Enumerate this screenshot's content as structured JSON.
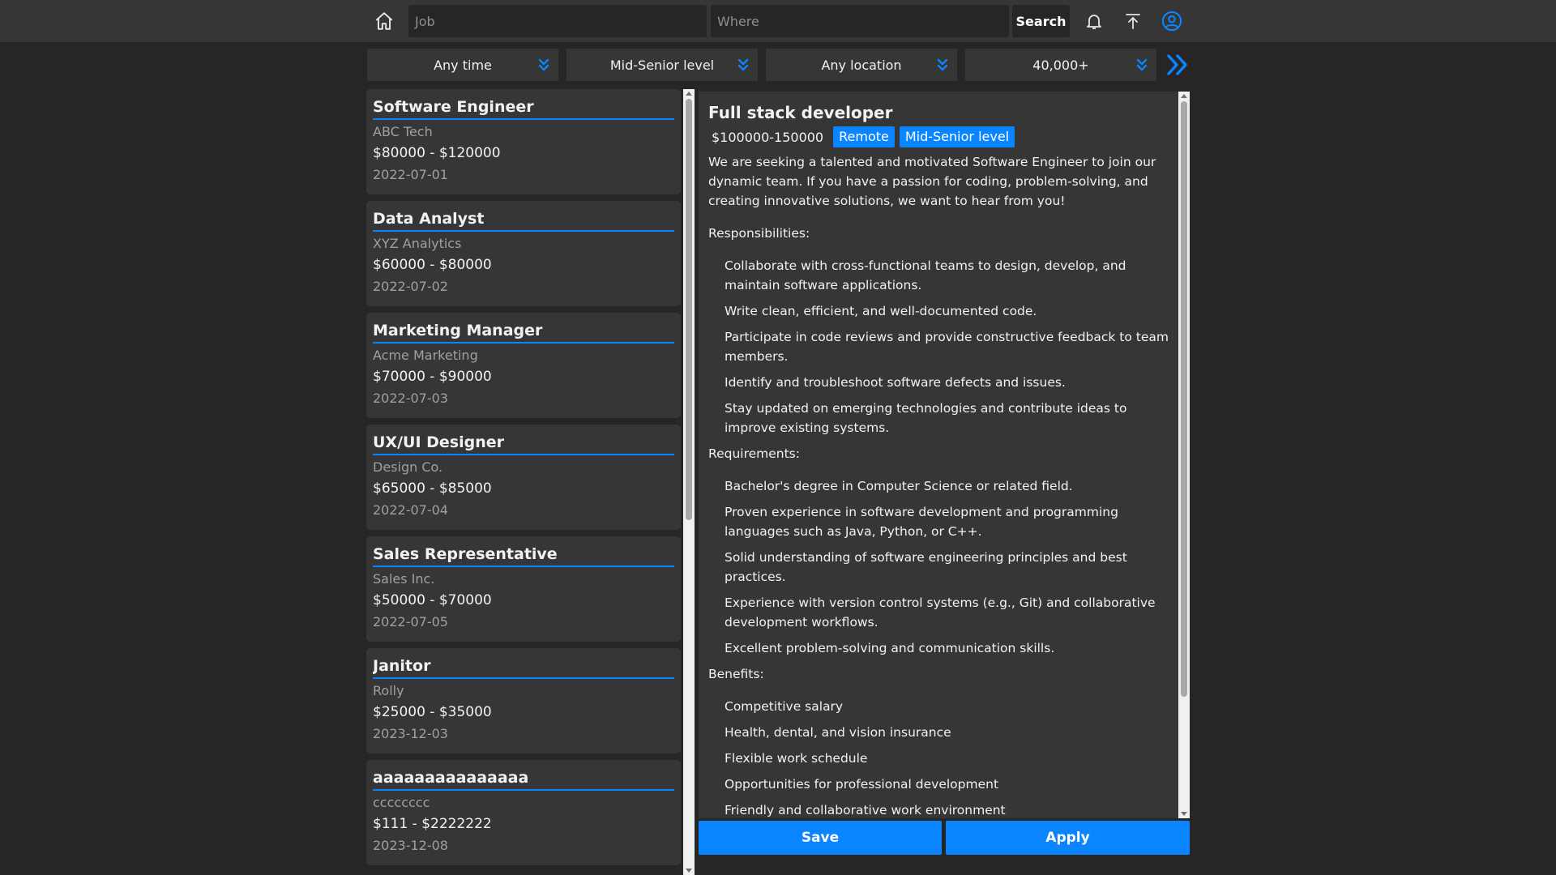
{
  "colors": {
    "accent": "#0a84ff",
    "background": "#262626",
    "surface": "#363636"
  },
  "header": {
    "home_icon": "home-icon",
    "job_placeholder": "Job",
    "where_placeholder": "Where",
    "search_label": "Search",
    "notification_icon": "bell-icon",
    "upload_icon": "upload-icon",
    "profile_icon": "user-circle-icon"
  },
  "filters": {
    "time": "Any time",
    "level": "Mid-Senior level",
    "location": "Any location",
    "salary": "40,000+"
  },
  "jobs": [
    {
      "title": "Software Engineer",
      "company": "ABC Tech",
      "salary": "$80000 - $120000",
      "date": "2022-07-01"
    },
    {
      "title": "Data Analyst",
      "company": "XYZ Analytics",
      "salary": "$60000 - $80000",
      "date": "2022-07-02"
    },
    {
      "title": "Marketing Manager",
      "company": "Acme Marketing",
      "salary": "$70000 - $90000",
      "date": "2022-07-03"
    },
    {
      "title": "UX/UI Designer",
      "company": "Design Co.",
      "salary": "$65000 - $85000",
      "date": "2022-07-04"
    },
    {
      "title": "Sales Representative",
      "company": "Sales Inc.",
      "salary": "$50000 - $70000",
      "date": "2022-07-05"
    },
    {
      "title": "Janitor",
      "company": "Rolly",
      "salary": "$25000 - $35000",
      "date": "2023-12-03"
    },
    {
      "title": "aaaaaaaaaaaaaaa",
      "company": "cccccccc",
      "salary": "$111 - $2222222",
      "date": "2023-12-08"
    }
  ],
  "detail": {
    "title": "Full stack developer",
    "salary": "$100000-150000",
    "badge_type": "Remote",
    "badge_level": "Mid-Senior level",
    "intro": "We are seeking a talented and motivated Software Engineer to join our dynamic team. If you have a passion for coding, problem-solving, and creating innovative solutions, we want to hear from you!",
    "responsibilities_title": "Responsibilities:",
    "responsibilities": [
      "Collaborate with cross-functional teams to design, develop, and maintain software applications.",
      "Write clean, efficient, and well-documented code.",
      "Participate in code reviews and provide constructive feedback to team members.",
      "Identify and troubleshoot software defects and issues.",
      "Stay updated on emerging technologies and contribute ideas to improve existing systems."
    ],
    "requirements_title": "Requirements:",
    "requirements": [
      "Bachelor's degree in Computer Science or related field.",
      "Proven experience in software development and programming languages such as Java, Python, or C++.",
      "Solid understanding of software engineering principles and best practices.",
      "Experience with version control systems (e.g., Git) and collaborative development workflows.",
      "Excellent problem-solving and communication skills."
    ],
    "benefits_title": "Benefits:",
    "benefits": [
      "Competitive salary",
      "Health, dental, and vision insurance",
      "Flexible work schedule",
      "Opportunities for professional development",
      "Friendly and collaborative work environment"
    ]
  },
  "actions": {
    "save_label": "Save",
    "apply_label": "Apply"
  }
}
